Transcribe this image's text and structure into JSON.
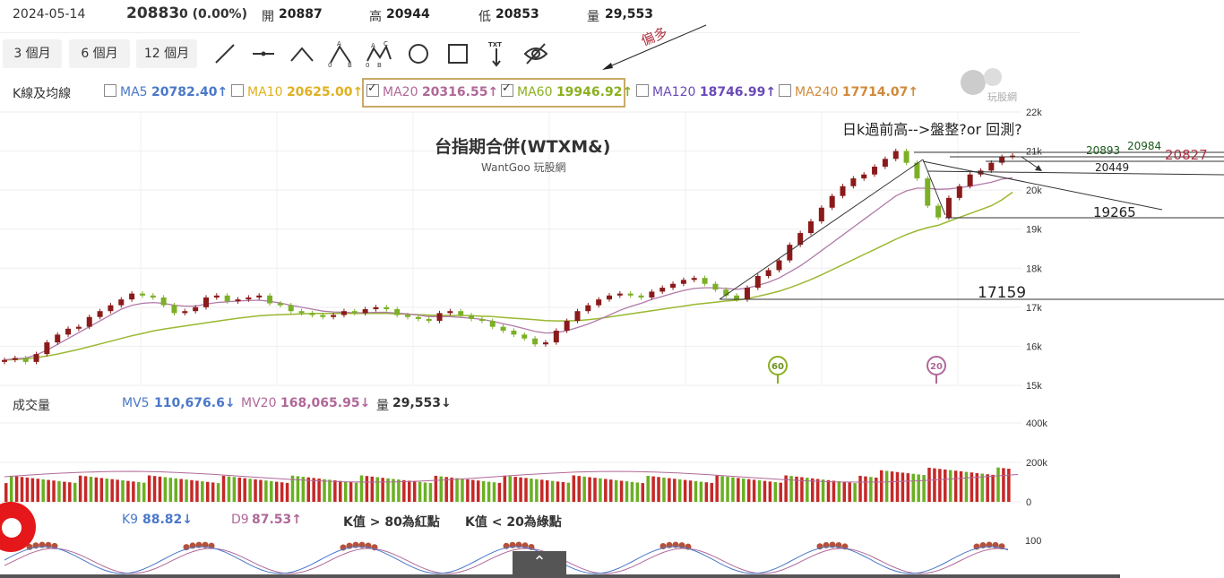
{
  "quote": {
    "date": "2024-05-14",
    "price": "20883",
    "change": "0 (0.00%)",
    "open_label": "開",
    "open": "20887",
    "high_label": "高",
    "high": "20944",
    "low_label": "低",
    "low": "20853",
    "volume_label": "量",
    "volume": "29,553"
  },
  "periods": [
    "3 個月",
    "6 個月",
    "12 個月"
  ],
  "tools": [
    "line-tool-icon",
    "horizontal-line-icon",
    "peak-tool-icon",
    "abc-pattern-icon",
    "abcd-pattern-icon",
    "circle-tool-icon",
    "rect-tool-icon",
    "text-tool-icon",
    "hide-icon"
  ],
  "ma_legend": {
    "title": "K線及均線",
    "items": [
      {
        "name": "MA5",
        "value": "20782.40↑",
        "color": "#4a78c8",
        "checked": false
      },
      {
        "name": "MA10",
        "value": "20625.00↑",
        "color": "#e0b020",
        "checked": false
      },
      {
        "name": "MA20",
        "value": "20316.55↑",
        "color": "#b06898",
        "checked": true
      },
      {
        "name": "MA60",
        "value": "19946.92↑",
        "color": "#8ab020",
        "checked": true
      },
      {
        "name": "MA120",
        "value": "18746.99↑",
        "color": "#6a4ab8",
        "checked": false
      },
      {
        "name": "MA240",
        "value": "17714.07↑",
        "color": "#d08a3a",
        "checked": false
      }
    ]
  },
  "volume_legend": {
    "title": "成交量",
    "mv5_label": "MV5",
    "mv5": "110,676.6↓",
    "mv20_label": "MV20",
    "mv20": "168,065.95↓",
    "vol_label": "量",
    "vol": "29,553↓"
  },
  "kd_legend": {
    "k_label": "K9",
    "k": "88.82↓",
    "d_label": "D9",
    "d": "87.53↑",
    "note1": "K值 > 80為紅點",
    "note2": "K值 < 20為綠點"
  },
  "annotations": {
    "bias": "偏多",
    "question": "日k過前高-->盤整?or 回測?",
    "levels": [
      "20984",
      "20893",
      "20827",
      "20449",
      "19265",
      "17159"
    ],
    "marker60": "60",
    "marker20": "20"
  },
  "colors": {
    "up": "#8b1a1a",
    "down": "#7bb026",
    "ma20": "#b07aa8",
    "ma60": "#9ab830",
    "vol_up": "#c62828",
    "vol_down": "#6ab023"
  },
  "chart_data": {
    "type": "candlestick",
    "title": "台指期合併(WTXM&)",
    "subtitle": "WantGoo 玩股網",
    "ylim": [
      15000,
      22000
    ],
    "yticks": [
      "15k",
      "16k",
      "17k",
      "18k",
      "19k",
      "20k",
      "21k",
      "22k"
    ],
    "closes": [
      15650,
      15700,
      15600,
      15800,
      16100,
      16300,
      16450,
      16500,
      16750,
      16900,
      17050,
      17200,
      17350,
      17300,
      17250,
      17050,
      16850,
      16900,
      17000,
      17250,
      17300,
      17150,
      17200,
      17250,
      17300,
      17100,
      17050,
      16900,
      16850,
      16800,
      16750,
      16800,
      16900,
      16850,
      16950,
      17000,
      16950,
      16800,
      16750,
      16700,
      16650,
      16850,
      16900,
      16800,
      16700,
      16650,
      16500,
      16400,
      16300,
      16200,
      16050,
      16100,
      16400,
      16650,
      16900,
      17050,
      17200,
      17300,
      17350,
      17300,
      17250,
      17400,
      17500,
      17600,
      17700,
      17750,
      17600,
      17450,
      17300,
      17200,
      17500,
      17800,
      17950,
      18200,
      18600,
      18900,
      19200,
      19550,
      19850,
      20100,
      20300,
      20400,
      20600,
      20800,
      21000,
      20700,
      20300,
      19600,
      19300,
      19800,
      20100,
      20400,
      20500,
      20700,
      20850,
      20883
    ],
    "ma20": [
      15650,
      15680,
      15700,
      15780,
      15900,
      16050,
      16200,
      16350,
      16500,
      16650,
      16800,
      16950,
      17050,
      17100,
      17120,
      17100,
      17050,
      17030,
      17030,
      17080,
      17120,
      17140,
      17160,
      17170,
      17180,
      17150,
      17110,
      17050,
      17000,
      16950,
      16900,
      16880,
      16870,
      16860,
      16860,
      16870,
      16870,
      16850,
      16830,
      16800,
      16760,
      16760,
      16760,
      16740,
      16720,
      16690,
      16640,
      16580,
      16520,
      16450,
      16380,
      16340,
      16350,
      16400,
      16480,
      16570,
      16680,
      16800,
      16920,
      17020,
      17100,
      17200,
      17280,
      17360,
      17430,
      17480,
      17500,
      17500,
      17480,
      17460,
      17490,
      17560,
      17640,
      17750,
      17900,
      18060,
      18250,
      18450,
      18650,
      18850,
      19050,
      19250,
      19450,
      19650,
      19850,
      19980,
      20050,
      20050,
      20020,
      20030,
      20060,
      20100,
      20150,
      20200,
      20280,
      20316
    ],
    "ma60": [
      15650,
      15660,
      15680,
      15710,
      15750,
      15800,
      15860,
      15920,
      15990,
      16060,
      16130,
      16200,
      16270,
      16330,
      16390,
      16440,
      16480,
      16520,
      16560,
      16600,
      16640,
      16680,
      16720,
      16750,
      16780,
      16800,
      16810,
      16820,
      16830,
      16840,
      16840,
      16840,
      16840,
      16840,
      16840,
      16840,
      16840,
      16830,
      16820,
      16810,
      16800,
      16790,
      16790,
      16790,
      16780,
      16770,
      16760,
      16740,
      16720,
      16700,
      16680,
      16660,
      16650,
      16650,
      16660,
      16680,
      16710,
      16750,
      16790,
      16830,
      16870,
      16910,
      16950,
      16990,
      17030,
      17070,
      17100,
      17130,
      17160,
      17180,
      17220,
      17280,
      17340,
      17410,
      17500,
      17600,
      17710,
      17830,
      17960,
      18090,
      18220,
      18350,
      18480,
      18610,
      18740,
      18860,
      18960,
      19040,
      19100,
      19200,
      19300,
      19400,
      19500,
      19600,
      19750,
      19947
    ]
  }
}
